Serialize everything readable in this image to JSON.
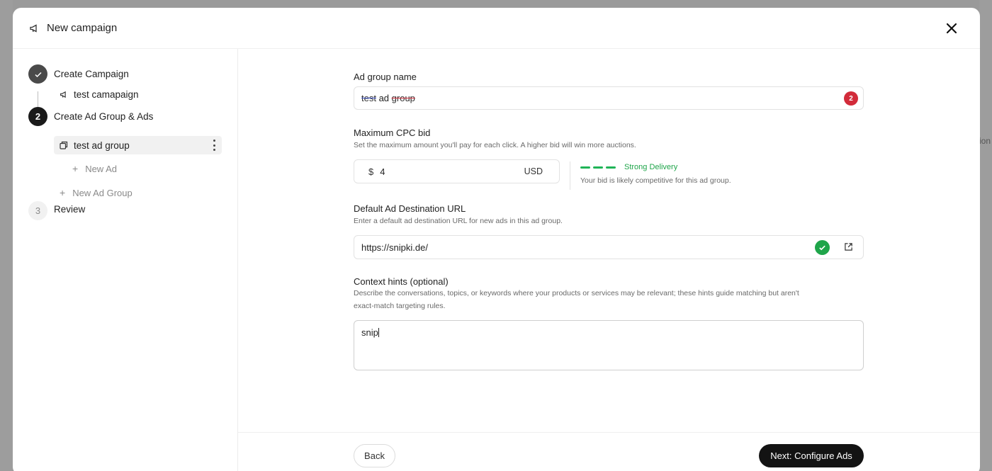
{
  "header": {
    "title": "New campaign",
    "icon": "megaphone-icon",
    "close_icon": "close-icon"
  },
  "background": {
    "peek_text": "ion"
  },
  "sidebar": {
    "steps": [
      {
        "number": "✓",
        "label": "Create Campaign",
        "state": "done"
      },
      {
        "number": "2",
        "label": "Create Ad Group & Ads",
        "state": "active"
      },
      {
        "number": "3",
        "label": "Review",
        "state": "todo"
      }
    ],
    "campaign_item": {
      "label": "test camapaign",
      "icon": "megaphone-icon"
    },
    "ad_group_item": {
      "label": "test ad group",
      "icon": "layers-icon"
    },
    "new_ad": "New Ad",
    "new_ad_group": "New Ad Group"
  },
  "form": {
    "ad_group_name": {
      "label": "Ad group name",
      "value_parts": [
        "test",
        " ad ",
        "group"
      ],
      "error_count": "2"
    },
    "max_cpc": {
      "label": "Maximum CPC bid",
      "help": "Set the maximum amount you'll pay for each click. A higher bid will win more auctions.",
      "currency_symbol": "$",
      "value": "4",
      "currency": "USD",
      "delivery_label": "Strong Delivery",
      "delivery_note": "Your bid is likely competitive for this ad group.",
      "delivery_color": "#1fa54a"
    },
    "destination_url": {
      "label": "Default Ad Destination URL",
      "help": "Enter a default ad destination URL for new ads in this ad group.",
      "value": "https://snipki.de/"
    },
    "context_hints": {
      "label": "Context hints (optional)",
      "help_line1": "Describe the conversations, topics, or keywords where your products or services may be relevant; these hints guide matching but aren't",
      "help_line2": "exact-match targeting rules.",
      "value": "snip"
    }
  },
  "footer": {
    "back": "Back",
    "next": "Next: Configure Ads"
  }
}
